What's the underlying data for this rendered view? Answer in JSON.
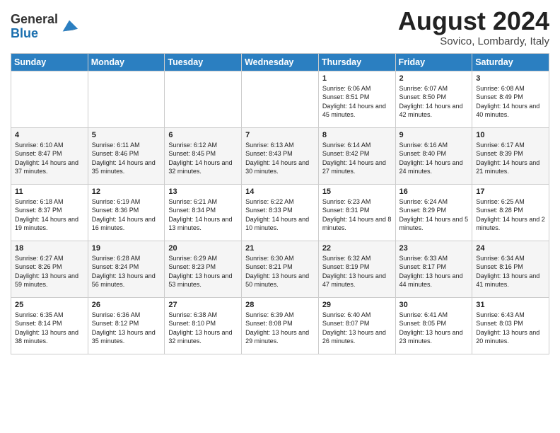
{
  "header": {
    "logo_general": "General",
    "logo_blue": "Blue",
    "month_year": "August 2024",
    "location": "Sovico, Lombardy, Italy"
  },
  "weekdays": [
    "Sunday",
    "Monday",
    "Tuesday",
    "Wednesday",
    "Thursday",
    "Friday",
    "Saturday"
  ],
  "weeks": [
    [
      {
        "day": "",
        "info": ""
      },
      {
        "day": "",
        "info": ""
      },
      {
        "day": "",
        "info": ""
      },
      {
        "day": "",
        "info": ""
      },
      {
        "day": "1",
        "info": "Sunrise: 6:06 AM\nSunset: 8:51 PM\nDaylight: 14 hours and 45 minutes."
      },
      {
        "day": "2",
        "info": "Sunrise: 6:07 AM\nSunset: 8:50 PM\nDaylight: 14 hours and 42 minutes."
      },
      {
        "day": "3",
        "info": "Sunrise: 6:08 AM\nSunset: 8:49 PM\nDaylight: 14 hours and 40 minutes."
      }
    ],
    [
      {
        "day": "4",
        "info": "Sunrise: 6:10 AM\nSunset: 8:47 PM\nDaylight: 14 hours and 37 minutes."
      },
      {
        "day": "5",
        "info": "Sunrise: 6:11 AM\nSunset: 8:46 PM\nDaylight: 14 hours and 35 minutes."
      },
      {
        "day": "6",
        "info": "Sunrise: 6:12 AM\nSunset: 8:45 PM\nDaylight: 14 hours and 32 minutes."
      },
      {
        "day": "7",
        "info": "Sunrise: 6:13 AM\nSunset: 8:43 PM\nDaylight: 14 hours and 30 minutes."
      },
      {
        "day": "8",
        "info": "Sunrise: 6:14 AM\nSunset: 8:42 PM\nDaylight: 14 hours and 27 minutes."
      },
      {
        "day": "9",
        "info": "Sunrise: 6:16 AM\nSunset: 8:40 PM\nDaylight: 14 hours and 24 minutes."
      },
      {
        "day": "10",
        "info": "Sunrise: 6:17 AM\nSunset: 8:39 PM\nDaylight: 14 hours and 21 minutes."
      }
    ],
    [
      {
        "day": "11",
        "info": "Sunrise: 6:18 AM\nSunset: 8:37 PM\nDaylight: 14 hours and 19 minutes."
      },
      {
        "day": "12",
        "info": "Sunrise: 6:19 AM\nSunset: 8:36 PM\nDaylight: 14 hours and 16 minutes."
      },
      {
        "day": "13",
        "info": "Sunrise: 6:21 AM\nSunset: 8:34 PM\nDaylight: 14 hours and 13 minutes."
      },
      {
        "day": "14",
        "info": "Sunrise: 6:22 AM\nSunset: 8:33 PM\nDaylight: 14 hours and 10 minutes."
      },
      {
        "day": "15",
        "info": "Sunrise: 6:23 AM\nSunset: 8:31 PM\nDaylight: 14 hours and 8 minutes."
      },
      {
        "day": "16",
        "info": "Sunrise: 6:24 AM\nSunset: 8:29 PM\nDaylight: 14 hours and 5 minutes."
      },
      {
        "day": "17",
        "info": "Sunrise: 6:25 AM\nSunset: 8:28 PM\nDaylight: 14 hours and 2 minutes."
      }
    ],
    [
      {
        "day": "18",
        "info": "Sunrise: 6:27 AM\nSunset: 8:26 PM\nDaylight: 13 hours and 59 minutes."
      },
      {
        "day": "19",
        "info": "Sunrise: 6:28 AM\nSunset: 8:24 PM\nDaylight: 13 hours and 56 minutes."
      },
      {
        "day": "20",
        "info": "Sunrise: 6:29 AM\nSunset: 8:23 PM\nDaylight: 13 hours and 53 minutes."
      },
      {
        "day": "21",
        "info": "Sunrise: 6:30 AM\nSunset: 8:21 PM\nDaylight: 13 hours and 50 minutes."
      },
      {
        "day": "22",
        "info": "Sunrise: 6:32 AM\nSunset: 8:19 PM\nDaylight: 13 hours and 47 minutes."
      },
      {
        "day": "23",
        "info": "Sunrise: 6:33 AM\nSunset: 8:17 PM\nDaylight: 13 hours and 44 minutes."
      },
      {
        "day": "24",
        "info": "Sunrise: 6:34 AM\nSunset: 8:16 PM\nDaylight: 13 hours and 41 minutes."
      }
    ],
    [
      {
        "day": "25",
        "info": "Sunrise: 6:35 AM\nSunset: 8:14 PM\nDaylight: 13 hours and 38 minutes."
      },
      {
        "day": "26",
        "info": "Sunrise: 6:36 AM\nSunset: 8:12 PM\nDaylight: 13 hours and 35 minutes."
      },
      {
        "day": "27",
        "info": "Sunrise: 6:38 AM\nSunset: 8:10 PM\nDaylight: 13 hours and 32 minutes."
      },
      {
        "day": "28",
        "info": "Sunrise: 6:39 AM\nSunset: 8:08 PM\nDaylight: 13 hours and 29 minutes."
      },
      {
        "day": "29",
        "info": "Sunrise: 6:40 AM\nSunset: 8:07 PM\nDaylight: 13 hours and 26 minutes."
      },
      {
        "day": "30",
        "info": "Sunrise: 6:41 AM\nSunset: 8:05 PM\nDaylight: 13 hours and 23 minutes."
      },
      {
        "day": "31",
        "info": "Sunrise: 6:43 AM\nSunset: 8:03 PM\nDaylight: 13 hours and 20 minutes."
      }
    ]
  ]
}
